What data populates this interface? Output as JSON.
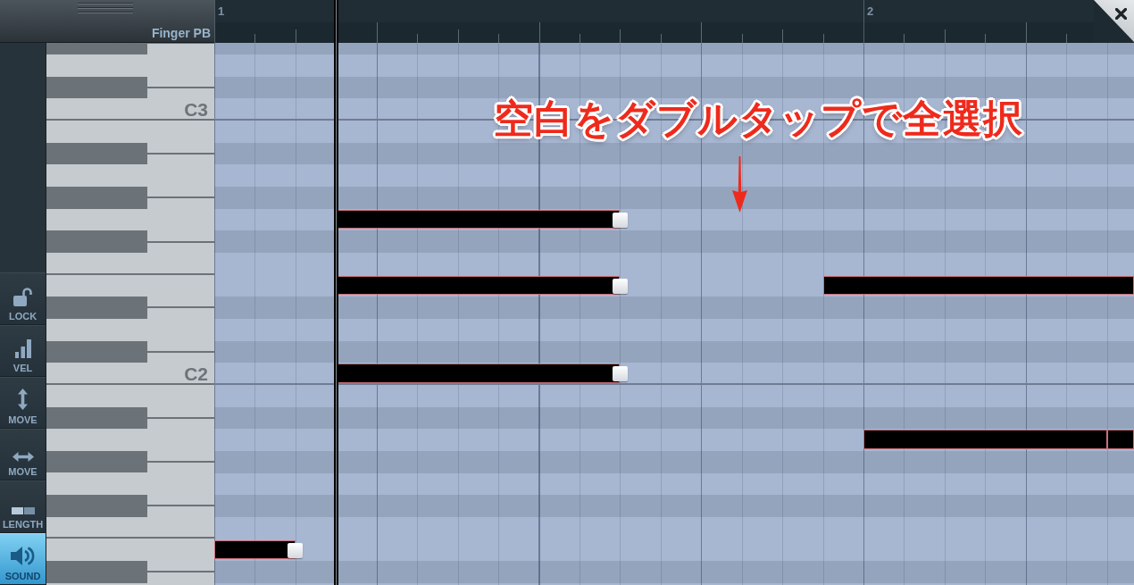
{
  "track_header": {
    "name": "Finger PB"
  },
  "tools": [
    {
      "kind": "lock",
      "label": "LOCK",
      "selected": false
    },
    {
      "kind": "velocity",
      "label": "VEL",
      "selected": false
    },
    {
      "kind": "move_vertical",
      "label": "MOVE",
      "selected": false
    },
    {
      "kind": "move_horizontal",
      "label": "MOVE",
      "selected": false
    },
    {
      "kind": "length",
      "label": "LENGTH",
      "selected": false
    },
    {
      "kind": "sound",
      "label": "SOUND",
      "selected": true
    }
  ],
  "ruler": {
    "bars": [
      "1",
      "2"
    ]
  },
  "piano_roll": {
    "rows": [
      {
        "kind": "black"
      },
      {
        "kind": "white"
      },
      {
        "kind": "black"
      },
      {
        "kind": "white",
        "label": "C3"
      },
      {
        "kind": "white"
      },
      {
        "kind": "black"
      },
      {
        "kind": "white"
      },
      {
        "kind": "black"
      },
      {
        "kind": "white",
        "notes": [
          {
            "selected": true
          }
        ]
      },
      {
        "kind": "black"
      },
      {
        "kind": "white"
      },
      {
        "kind": "white",
        "notes": [
          {
            "selected": true
          },
          {
            "selected": true
          }
        ]
      },
      {
        "kind": "black"
      },
      {
        "kind": "white"
      },
      {
        "kind": "black"
      },
      {
        "kind": "white",
        "label": "C2",
        "notes": [
          {
            "selected": true
          }
        ]
      },
      {
        "kind": "white"
      },
      {
        "kind": "black"
      },
      {
        "kind": "white",
        "notes": [
          {
            "selected": true
          },
          {
            "selected": true
          }
        ]
      },
      {
        "kind": "black"
      },
      {
        "kind": "white"
      },
      {
        "kind": "black"
      },
      {
        "kind": "white"
      },
      {
        "kind": "white",
        "notes": [
          {
            "selected": true
          }
        ]
      },
      {
        "kind": "black"
      },
      {
        "kind": "white"
      }
    ]
  },
  "annotation": {
    "text": "空白をダブルタップで全選択"
  }
}
